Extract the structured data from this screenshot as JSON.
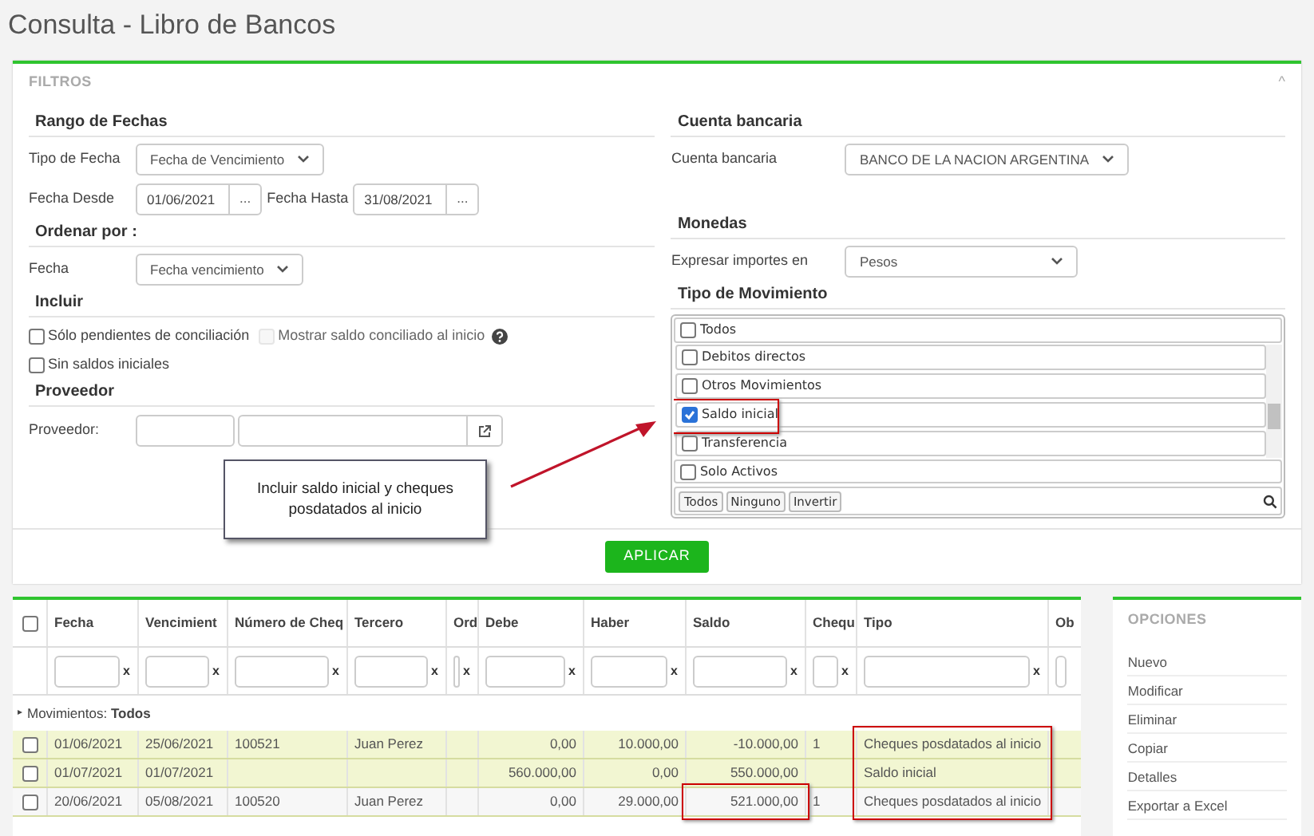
{
  "page_title": "Consulta - Libro de Bancos",
  "filters": {
    "title": "FILTROS",
    "collapse_glyph": "^",
    "left": [
      {
        "kind": "section",
        "label": "Rango de Fechas"
      },
      {
        "kind": "select",
        "label": "Tipo de Fecha",
        "value": "Fecha de Vencimiento"
      },
      {
        "kind": "dates",
        "label": "Fecha Desde",
        "value": "01/06/2021",
        "button": "...",
        "label2": "Fecha Hasta",
        "value2": "31/08/2021",
        "button2": "..."
      },
      {
        "kind": "section",
        "label": "Ordenar por :"
      },
      {
        "kind": "select",
        "label": "Fecha",
        "value": "Fecha vencimiento"
      },
      {
        "kind": "section",
        "label": "Incluir"
      },
      {
        "kind": "checks",
        "items": [
          {
            "label": "Sólo pendientes de conciliación",
            "checked": false,
            "disabled": false
          },
          {
            "label": "Mostrar saldo conciliado al inicio",
            "checked": false,
            "disabled": true,
            "help": true
          }
        ]
      },
      {
        "kind": "checks",
        "items": [
          {
            "label": "Sin saldos iniciales",
            "checked": false,
            "disabled": false
          }
        ]
      },
      {
        "kind": "section",
        "label": "Proveedor"
      },
      {
        "kind": "lookup",
        "label": "Proveedor:"
      }
    ],
    "right": [
      {
        "kind": "section",
        "label": "Cuenta bancaria"
      },
      {
        "kind": "select",
        "label": "Cuenta bancaria",
        "value": "BANCO DE LA NACION ARGENTINA"
      },
      {
        "kind": "spacer"
      },
      {
        "kind": "section",
        "label": "Monedas"
      },
      {
        "kind": "select",
        "label": "Expresar importes en",
        "value": "Pesos"
      },
      {
        "kind": "section",
        "label": "Tipo de Movimiento"
      },
      {
        "kind": "multiselect",
        "all": {
          "label": "Todos",
          "checked": false
        },
        "items": [
          {
            "label": "Debitos directos",
            "checked": false,
            "outlined": false
          },
          {
            "label": "Otros Movimientos",
            "checked": false,
            "outlined": false
          },
          {
            "label": "Saldo inicial",
            "checked": true,
            "outlined": true
          },
          {
            "label": "Transferencia",
            "checked": false,
            "outlined": false
          }
        ],
        "active": {
          "label": "Solo Activos",
          "checked": false
        },
        "buttons": [
          "Todos",
          "Ninguno",
          "Invertir"
        ]
      }
    ],
    "apply": "APLICAR"
  },
  "annotation": {
    "text": "Incluir saldo inicial y cheques posdatados al inicio"
  },
  "table": {
    "columns": [
      "Fecha",
      "Vencimient",
      "Número de Cheq",
      "Tercero",
      "Ord",
      "Debe",
      "Haber",
      "Saldo",
      "Chequ",
      "Tipo",
      "Ob"
    ],
    "group": "Movimientos: **Todos**",
    "group_glyph": "▸",
    "clear_glyphs": [
      "x",
      "x",
      "x",
      "x",
      "x",
      "x",
      "x",
      "x",
      "x",
      "x"
    ],
    "select_all_checked": false,
    "rows": [
      {
        "highlighted": true,
        "checked": false,
        "cells": [
          "01/06/2021",
          "25/06/2021",
          "100521",
          "Juan Perez",
          "",
          "0,00",
          "10.000,00",
          "-10.000,00",
          "1",
          "Cheques posdatados al inicio",
          ""
        ]
      },
      {
        "highlighted": true,
        "checked": false,
        "cells": [
          "01/07/2021",
          "01/07/2021",
          "",
          "",
          "",
          "560.000,00",
          "0,00",
          "550.000,00",
          "",
          "Saldo inicial",
          ""
        ]
      },
      {
        "highlighted": false,
        "checked": false,
        "cells": [
          "20/06/2021",
          "05/08/2021",
          "100520",
          "Juan Perez",
          "",
          "0,00",
          "29.000,00",
          "521.000,00",
          "1",
          "Cheques posdatados al inicio",
          ""
        ]
      }
    ]
  },
  "options": {
    "title": "OPCIONES",
    "items": [
      "Nuevo",
      "Modificar",
      "Eliminar",
      "Copiar",
      "Detalles",
      "Exportar a Excel"
    ]
  }
}
